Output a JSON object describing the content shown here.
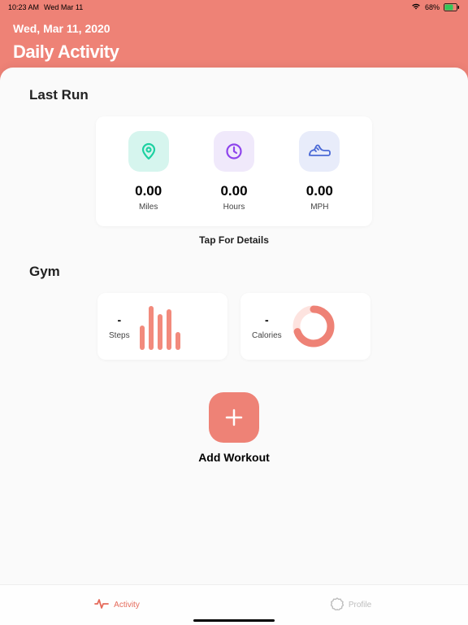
{
  "status": {
    "time": "10:23 AM",
    "date_short": "Wed Mar 11",
    "battery": "68%"
  },
  "header": {
    "date": "Wed, Mar 11, 2020",
    "title": "Daily Activity"
  },
  "last_run": {
    "section": "Last Run",
    "miles": {
      "value": "0.00",
      "label": "Miles"
    },
    "hours": {
      "value": "0.00",
      "label": "Hours"
    },
    "mph": {
      "value": "0.00",
      "label": "MPH"
    },
    "tap": "Tap For Details"
  },
  "gym": {
    "section": "Gym",
    "steps": {
      "value": "-",
      "label": "Steps"
    },
    "calories": {
      "value": "-",
      "label": "Calories"
    }
  },
  "add_workout": {
    "label": "Add Workout"
  },
  "tabs": {
    "activity": "Activity",
    "profile": "Profile"
  }
}
